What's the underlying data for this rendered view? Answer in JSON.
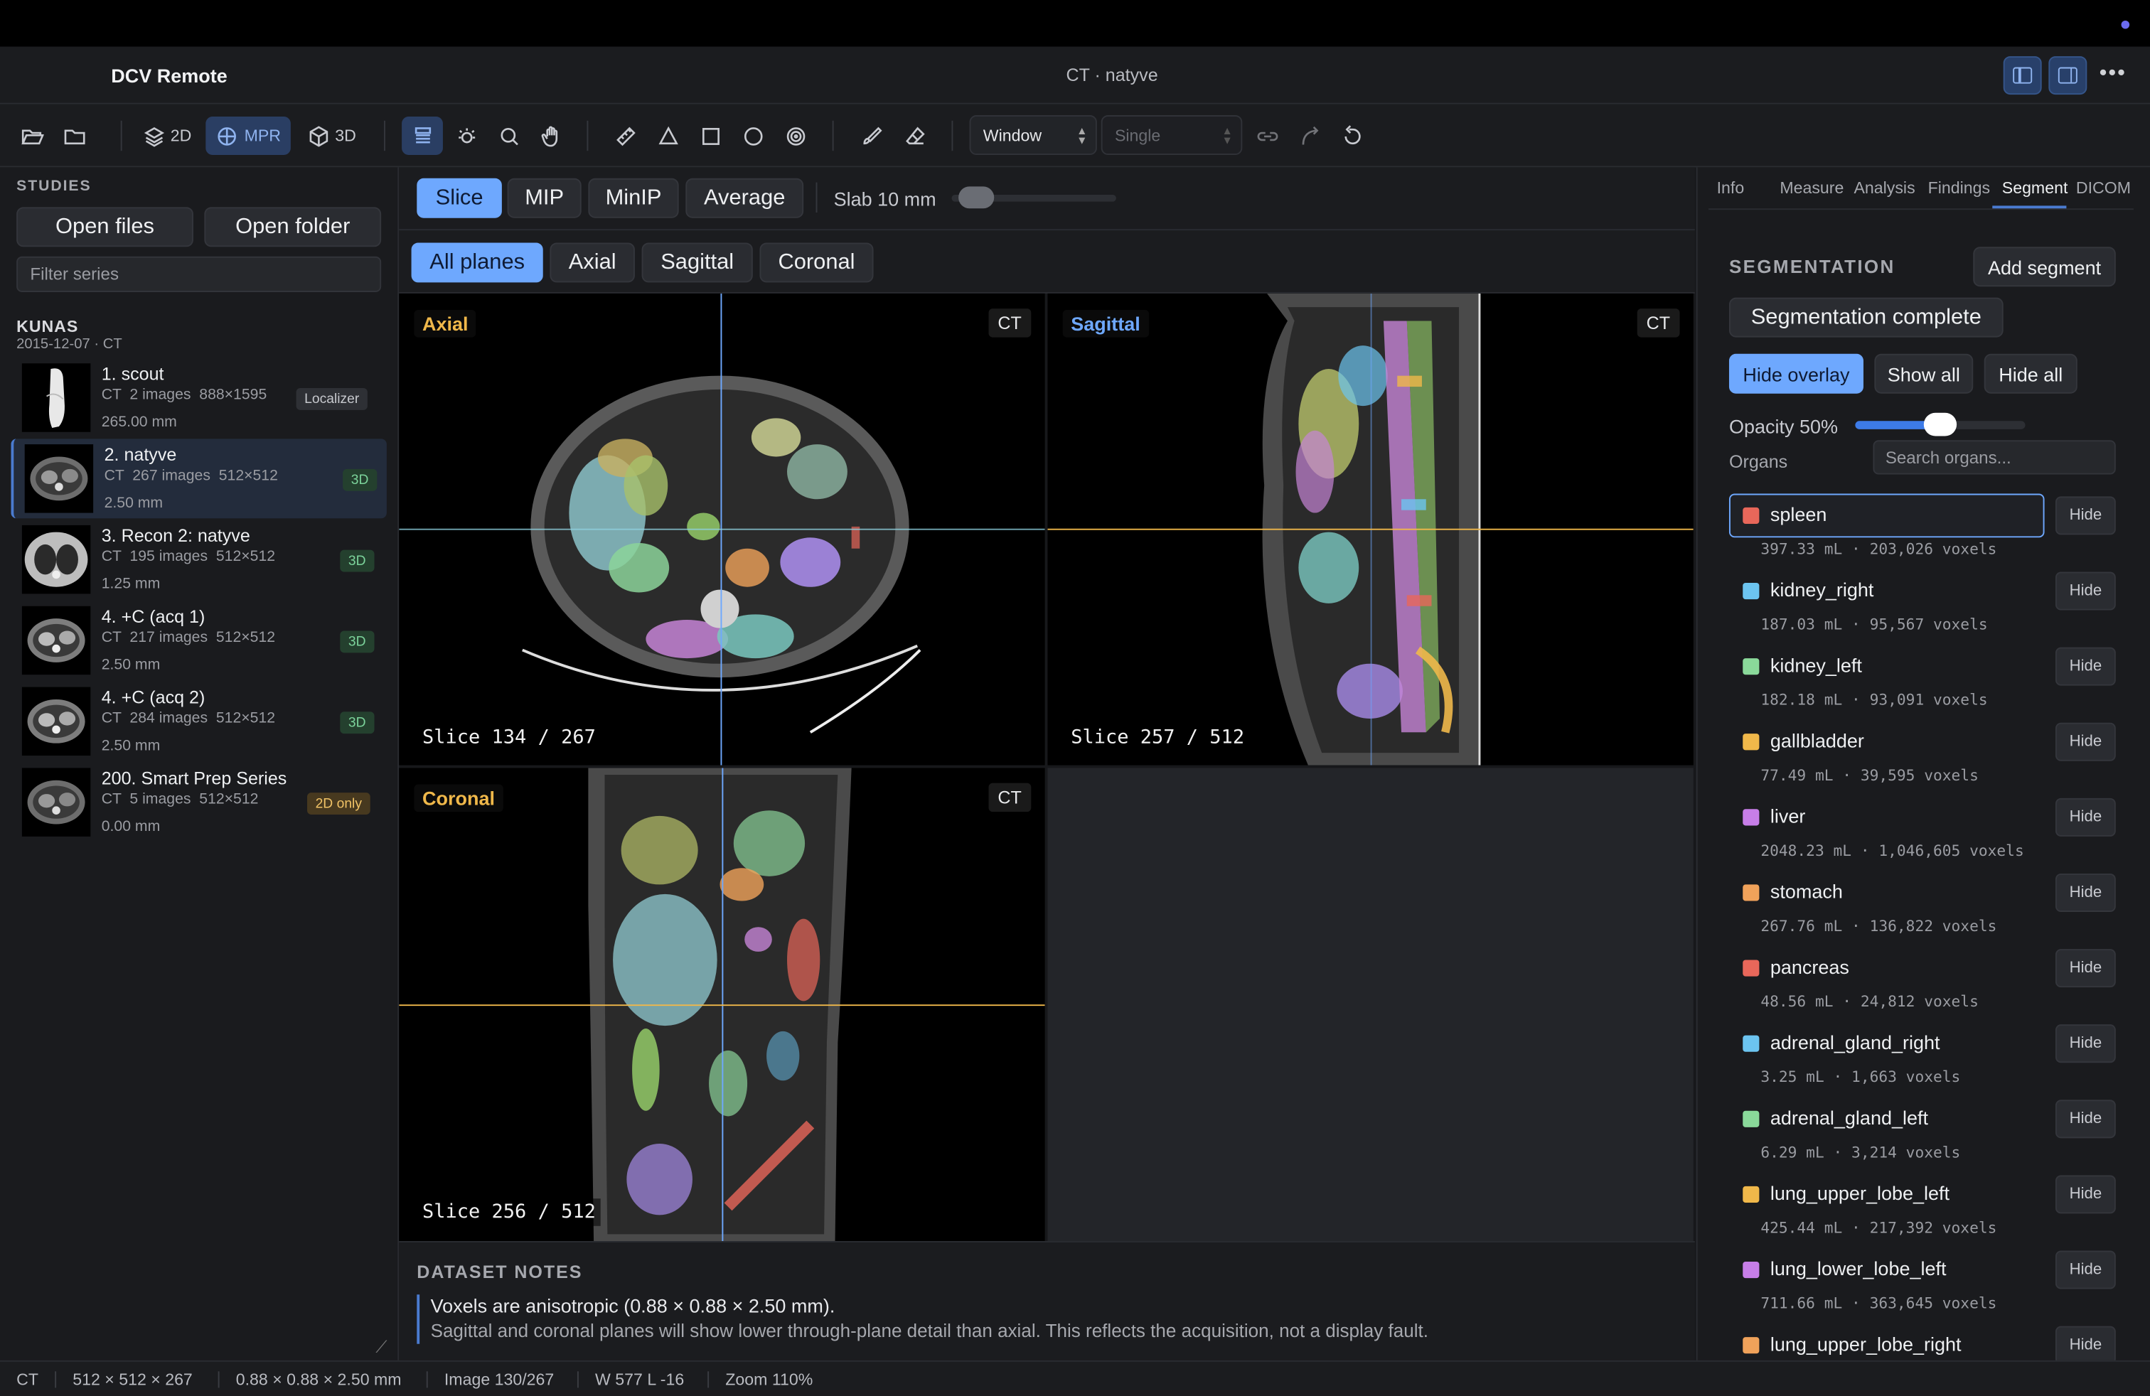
{
  "app": {
    "name": "DCV Remote",
    "title": "CT · natyve"
  },
  "toolbar": {
    "mode_2d": "2D",
    "mode_mpr": "MPR",
    "mode_3d": "3D",
    "window_select": "Window",
    "layout_select": "Single"
  },
  "sidebar": {
    "heading": "STUDIES",
    "open_files": "Open files",
    "open_folder": "Open folder",
    "filter_placeholder": "Filter series",
    "patient": "KUNAS",
    "study_date": "2015-12-07 · CT",
    "series": [
      {
        "title": "1. scout",
        "meta": "CT  2 images  888×1595",
        "thickness": "265.00 mm",
        "badge": "Localizer"
      },
      {
        "title": "2. natyve",
        "meta": "CT  267 images  512×512",
        "thickness": "2.50 mm",
        "badge": "3D"
      },
      {
        "title": "3. Recon 2: natyve",
        "meta": "CT  195 images  512×512",
        "thickness": "1.25 mm",
        "badge": "3D"
      },
      {
        "title": "4. +C (acq 1)",
        "meta": "CT  217 images  512×512",
        "thickness": "2.50 mm",
        "badge": "3D"
      },
      {
        "title": "4. +C (acq 2)",
        "meta": "CT  284 images  512×512",
        "thickness": "2.50 mm",
        "badge": "3D"
      },
      {
        "title": "200. Smart Prep Series",
        "meta": "CT  5 images  512×512",
        "thickness": "0.00 mm",
        "badge": "2D only"
      }
    ]
  },
  "projection": {
    "slice": "Slice",
    "mip": "MIP",
    "minip": "MinIP",
    "average": "Average",
    "slab_label": "Slab 10 mm"
  },
  "planes": {
    "all": "All planes",
    "axial": "Axial",
    "sagittal": "Sagittal",
    "coronal": "Coronal"
  },
  "viewports": {
    "axial": {
      "label": "Axial",
      "modality": "CT",
      "slice": "Slice 134 / 267"
    },
    "sagittal": {
      "label": "Sagittal",
      "modality": "CT",
      "slice": "Slice 257 / 512"
    },
    "coronal": {
      "label": "Coronal",
      "modality": "CT",
      "slice": "Slice 256 / 512"
    }
  },
  "notes": {
    "heading": "DATASET NOTES",
    "line1": "Voxels are anisotropic (0.88 × 0.88 × 2.50 mm).",
    "line2": "Sagittal and coronal planes will show lower through-plane detail than axial. This reflects the acquisition, not a display fault."
  },
  "right_panel": {
    "tabs": [
      "Info",
      "Measure",
      "Analysis",
      "Findings",
      "Segment",
      "DICOM"
    ],
    "active_tab": "Segment",
    "heading": "SEGMENTATION",
    "add_segment": "Add segment",
    "status": "Segmentation complete",
    "hide_overlay": "Hide overlay",
    "show_all": "Show all",
    "hide_all": "Hide all",
    "opacity_label": "Opacity 50%",
    "opacity": 0.5,
    "organs_label": "Organs",
    "search_placeholder": "Search organs...",
    "hide_label": "Hide",
    "organs": [
      {
        "name": "spleen",
        "volume": "397.33 mL · 203,026 voxels",
        "color": "#e8675a"
      },
      {
        "name": "kidney_right",
        "volume": "187.03 mL · 95,567 voxels",
        "color": "#6cc4f0"
      },
      {
        "name": "kidney_left",
        "volume": "182.18 mL · 93,091 voxels",
        "color": "#8ad99a"
      },
      {
        "name": "gallbladder",
        "volume": "77.49 mL · 39,595 voxels",
        "color": "#f0b84a"
      },
      {
        "name": "liver",
        "volume": "2048.23 mL · 1,046,605 voxels",
        "color": "#c77ee8"
      },
      {
        "name": "stomach",
        "volume": "267.76 mL · 136,822 voxels",
        "color": "#f0a25a"
      },
      {
        "name": "pancreas",
        "volume": "48.56 mL · 24,812 voxels",
        "color": "#e8675a"
      },
      {
        "name": "adrenal_gland_right",
        "volume": "3.25 mL · 1,663 voxels",
        "color": "#6cc4f0"
      },
      {
        "name": "adrenal_gland_left",
        "volume": "6.29 mL · 3,214 voxels",
        "color": "#8ad99a"
      },
      {
        "name": "lung_upper_lobe_left",
        "volume": "425.44 mL · 217,392 voxels",
        "color": "#f0b84a"
      },
      {
        "name": "lung_lower_lobe_left",
        "volume": "711.66 mL · 363,645 voxels",
        "color": "#c77ee8"
      },
      {
        "name": "lung_upper_lobe_right",
        "volume": "",
        "color": "#f0a25a"
      }
    ]
  },
  "status_bar": {
    "modality": "CT",
    "dims": "512 × 512 × 267",
    "spacing": "0.88 × 0.88 × 2.50 mm",
    "image": "Image 130/267",
    "window": "W 577 L -16",
    "zoom": "Zoom 110%"
  },
  "colors": {
    "accent": "#6ea8fe",
    "axial_label": "#f0b84a",
    "sagittal_label": "#6ea8fe",
    "coronal_label": "#f0b84a"
  }
}
